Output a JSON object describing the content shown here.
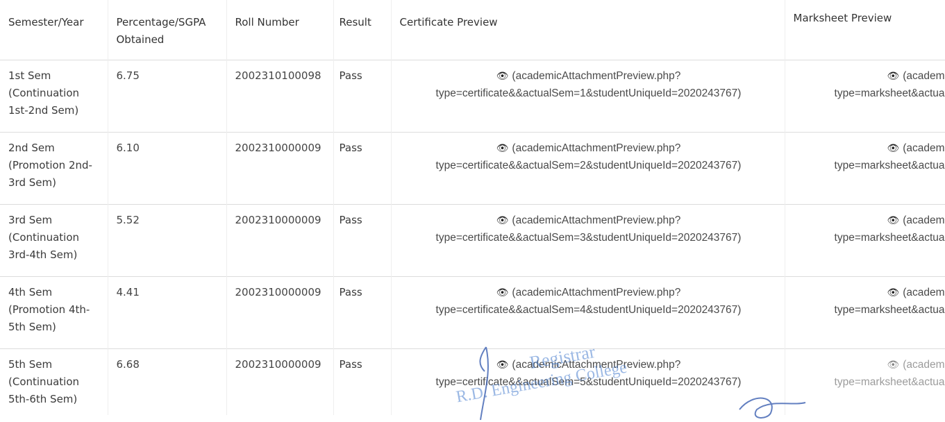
{
  "headers": {
    "sem": "Semester/Year",
    "pct": "Percentage/SGPA Obtained",
    "roll": "Roll Number",
    "result": "Result",
    "cert": "Certificate Preview",
    "mark": "Marksheet Preview"
  },
  "rows": [
    {
      "sem": "1st Sem (Continuation 1st-2nd Sem)",
      "pct": "6.75",
      "roll": "2002310100098",
      "result": "Pass",
      "cert_line1": "(academicAttachmentPreview.php?",
      "cert_line2": "type=certificate&&actualSem=1&studentUniqueId=2020243767)",
      "mark_line1": "(academ",
      "mark_line2": "type=marksheet&actua"
    },
    {
      "sem": "2nd Sem (Promotion 2nd-3rd Sem)",
      "pct": "6.10",
      "roll": "2002310000009",
      "result": "Pass",
      "cert_line1": "(academicAttachmentPreview.php?",
      "cert_line2": "type=certificate&&actualSem=2&studentUniqueId=2020243767)",
      "mark_line1": "(academ",
      "mark_line2": "type=marksheet&actua"
    },
    {
      "sem": "3rd Sem (Continuation 3rd-4th Sem)",
      "pct": "5.52",
      "roll": "2002310000009",
      "result": "Pass",
      "cert_line1": "(academicAttachmentPreview.php?",
      "cert_line2": "type=certificate&&actualSem=3&studentUniqueId=2020243767)",
      "mark_line1": "(academ",
      "mark_line2": "type=marksheet&actua"
    },
    {
      "sem": "4th Sem (Promotion 4th-5th Sem)",
      "pct": "4.41",
      "roll": "2002310000009",
      "result": "Pass",
      "cert_line1": "(academicAttachmentPreview.php?",
      "cert_line2": "type=certificate&&actualSem=4&studentUniqueId=2020243767)",
      "mark_line1": "(academ",
      "mark_line2": "type=marksheet&actua"
    },
    {
      "sem": "5th Sem (Continuation 5th-6th Sem)",
      "pct": "6.68",
      "roll": "2002310000009",
      "result": "Pass",
      "cert_line1": "(academicAttachmentPreview.php?",
      "cert_line2": "type=certificate&&actualSem=5&studentUniqueId=2020243767)",
      "mark_line1": "(academ",
      "mark_line2": "type=marksheet&actua"
    }
  ],
  "stamp": {
    "line1": "Registrar",
    "line2": "R.D. Engineering College"
  },
  "icons": {
    "preview": "eye-icon"
  },
  "colors": {
    "text": "#3a3a3a",
    "border": "#dcdcdc",
    "stamp": "#4a7fcf"
  }
}
